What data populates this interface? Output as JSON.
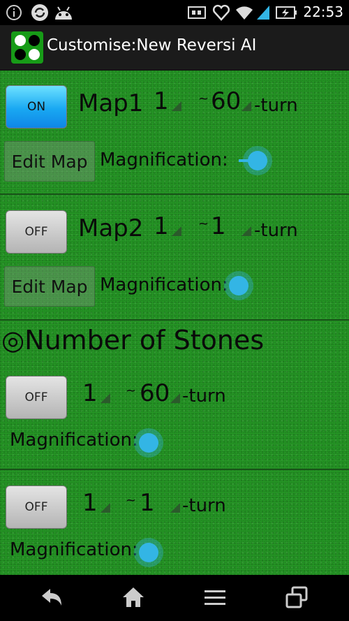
{
  "status_bar": {
    "time": "22:53"
  },
  "header": {
    "title": "Customise:New Reversi AI"
  },
  "map1": {
    "toggle": "ON",
    "name": "Map1",
    "from": "1",
    "tilde": "~",
    "to": "60",
    "unit": "-turn",
    "edit": "Edit Map",
    "mag_label": "Magnification:",
    "mag_value": 0.0
  },
  "map2": {
    "toggle": "OFF",
    "name": "Map2",
    "from": "1",
    "tilde": "~",
    "to": "1",
    "unit": "-turn",
    "edit": "Edit Map",
    "mag_label": "Magnification:",
    "mag_value": 0.0
  },
  "stones": {
    "heading": "◎Number of Stones",
    "rows": [
      {
        "toggle": "OFF",
        "from": "1",
        "tilde": "~",
        "to": "60",
        "unit": "-turn",
        "mag_label": "Magnification:",
        "mag_value": 0.0
      },
      {
        "toggle": "OFF",
        "from": "1",
        "tilde": "~",
        "to": "1",
        "unit": "-turn",
        "mag_label": "Magnification:",
        "mag_value": 0.0
      }
    ]
  },
  "nav": {
    "icons": [
      "back-icon",
      "home-icon",
      "menu-icon",
      "recent-apps-icon"
    ]
  },
  "colors": {
    "accent": "#33b5e5",
    "grass": "#259625",
    "toggle_on": "#19a8f2"
  }
}
